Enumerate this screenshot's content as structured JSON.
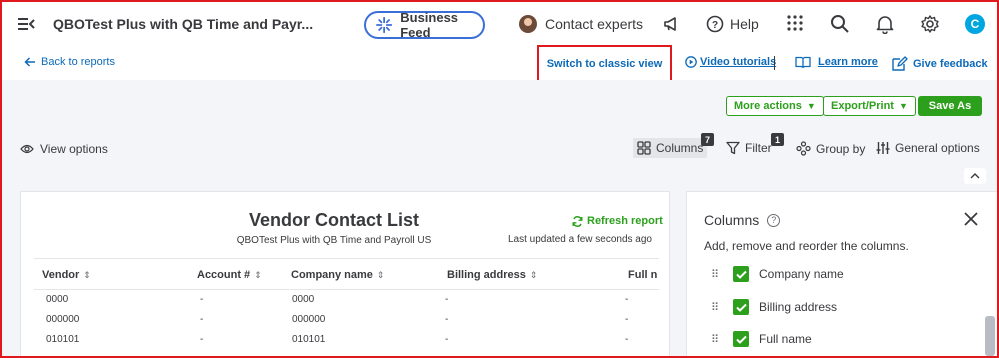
{
  "topbar": {
    "company_name": "QBOTest Plus with QB Time and Payr...",
    "business_feed": "Business Feed",
    "contact_experts": "Contact experts",
    "help": "Help",
    "user_initial": "C"
  },
  "subbar": {
    "back": "Back to reports",
    "classic_view": "Switch to classic view",
    "video_tutorials": "Video tutorials",
    "learn_more": "Learn more",
    "give_feedback": "Give feedback"
  },
  "actions": {
    "more_actions": "More actions",
    "export_print": "Export/Print",
    "save_as": "Save As"
  },
  "toolbar": {
    "view_options": "View options",
    "columns": "Columns",
    "columns_count": "7",
    "filter": "Filter",
    "filter_count": "1",
    "group_by": "Group by",
    "general_options": "General options"
  },
  "report": {
    "title": "Vendor Contact List",
    "subtitle": "QBOTest Plus with QB Time and Payroll US",
    "refresh": "Refresh report",
    "updated": "Last updated a few seconds ago",
    "columns": [
      "Vendor",
      "Account #",
      "Company name",
      "Billing address",
      "Full n"
    ],
    "rows": [
      [
        "0000",
        "-",
        "0000",
        "-",
        "-"
      ],
      [
        "000000",
        "-",
        "000000",
        "-",
        "-"
      ],
      [
        "010101",
        "-",
        "010101",
        "-",
        "-"
      ]
    ]
  },
  "panel": {
    "title": "Columns",
    "description": "Add, remove and reorder the columns.",
    "items": [
      "Company name",
      "Billing address",
      "Full name"
    ]
  },
  "colors": {
    "accent_green": "#2ca01c",
    "link_blue": "#0d6ab8",
    "highlight_red": "#e0191f"
  }
}
